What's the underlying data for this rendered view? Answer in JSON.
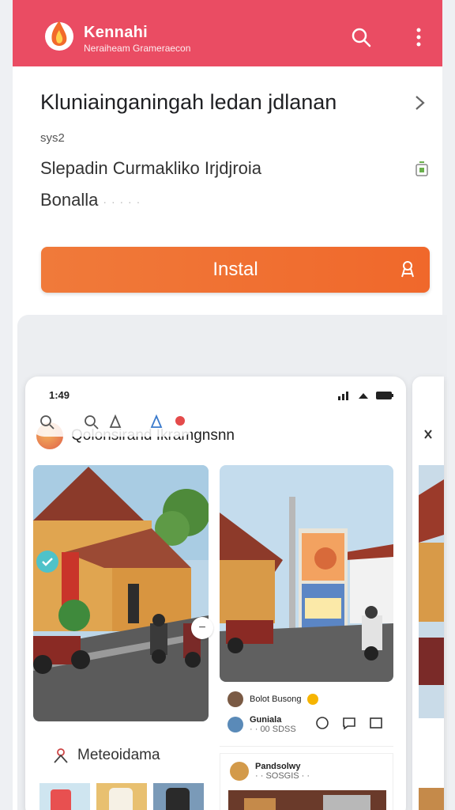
{
  "topbar": {
    "brand_name": "Kennahi",
    "brand_subtitle": "Neraiheam Grameraecon",
    "background": "#ea4c63"
  },
  "app": {
    "title": "Kluniainganingah ledan jdlanan",
    "meta_small": "sys2",
    "meta_line1": "Slepadin Curmakliko Irjdjroia",
    "meta_line2": "Bonalla",
    "meta_line2_suffix": "· · · · ·",
    "install_label": "Instal",
    "accent": "#f07a3a"
  },
  "phone": {
    "status_time": "1:49",
    "header_title": "Qolonsirand Ikramgnsnn",
    "card1_label": "Meteoidama",
    "post1_name": "Bolot Busong",
    "post1_user": "Guniala",
    "post1_sub": "· · 00 SDSS",
    "post2_name": "Pandsolwy",
    "post2_sub": "· · SOSGIS · ·"
  },
  "icons": {
    "search": "search-icon",
    "more": "more-vertical-icon",
    "chevron": "chevron-right-icon",
    "install": "install-icon",
    "share": "share-icon"
  }
}
